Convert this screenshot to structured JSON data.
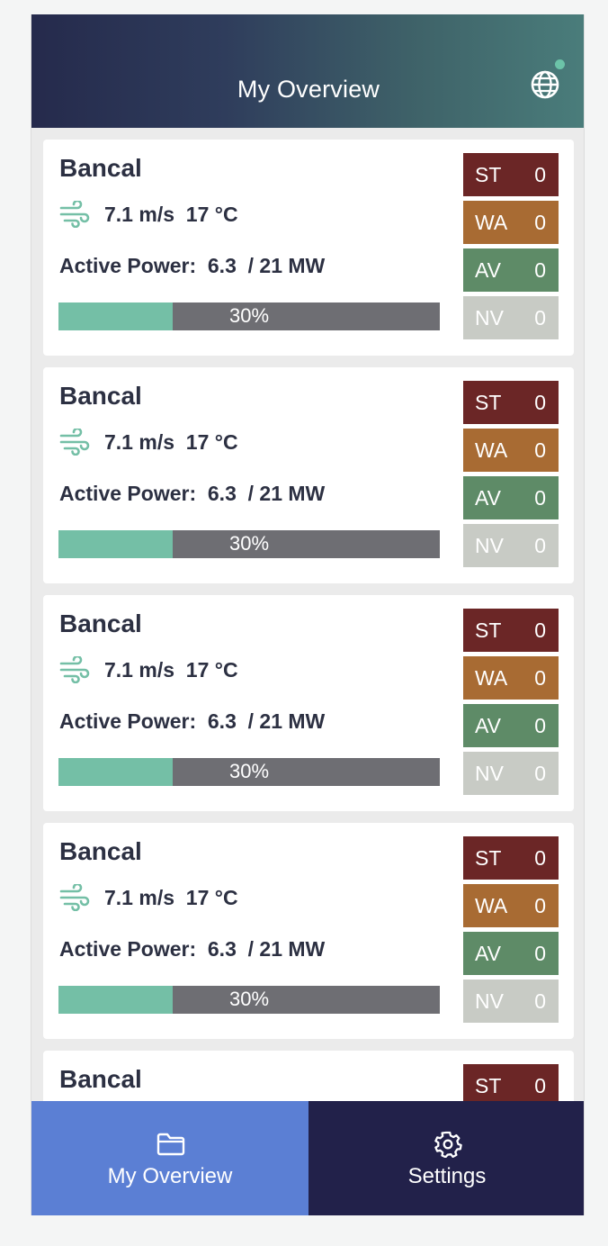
{
  "header": {
    "title": "My Overview",
    "language_icon": "globe-icon",
    "notification_color": "#6cc3a8"
  },
  "colors": {
    "header_gradient_start": "#252a4c",
    "header_gradient_end": "#4a7d7b",
    "progress_fill": "#74bfa6",
    "progress_track": "#6e6e73",
    "status_st": "#6b2626",
    "status_wa": "#a86b33",
    "status_av": "#5e8b67",
    "status_nv": "#c8cbc5",
    "nav_active": "#5b7fd4",
    "nav_inactive": "#22214a"
  },
  "sites": [
    {
      "name": "Bancal",
      "wind_icon": "wind-icon",
      "weather": "7.1 m/s  17 °C",
      "power": "Active Power:  6.3  / 21 MW",
      "progress_percent": 30,
      "progress_label": "30%",
      "statuses": [
        {
          "code": "ST",
          "count": "0"
        },
        {
          "code": "WA",
          "count": "0"
        },
        {
          "code": "AV",
          "count": "0"
        },
        {
          "code": "NV",
          "count": "0"
        }
      ]
    },
    {
      "name": "Bancal",
      "wind_icon": "wind-icon",
      "weather": "7.1 m/s  17 °C",
      "power": "Active Power:  6.3  / 21 MW",
      "progress_percent": 30,
      "progress_label": "30%",
      "statuses": [
        {
          "code": "ST",
          "count": "0"
        },
        {
          "code": "WA",
          "count": "0"
        },
        {
          "code": "AV",
          "count": "0"
        },
        {
          "code": "NV",
          "count": "0"
        }
      ]
    },
    {
      "name": "Bancal",
      "wind_icon": "wind-icon",
      "weather": "7.1 m/s  17 °C",
      "power": "Active Power:  6.3  / 21 MW",
      "progress_percent": 30,
      "progress_label": "30%",
      "statuses": [
        {
          "code": "ST",
          "count": "0"
        },
        {
          "code": "WA",
          "count": "0"
        },
        {
          "code": "AV",
          "count": "0"
        },
        {
          "code": "NV",
          "count": "0"
        }
      ]
    },
    {
      "name": "Bancal",
      "wind_icon": "wind-icon",
      "weather": "7.1 m/s  17 °C",
      "power": "Active Power:  6.3  / 21 MW",
      "progress_percent": 30,
      "progress_label": "30%",
      "statuses": [
        {
          "code": "ST",
          "count": "0"
        },
        {
          "code": "WA",
          "count": "0"
        },
        {
          "code": "AV",
          "count": "0"
        },
        {
          "code": "NV",
          "count": "0"
        }
      ]
    },
    {
      "name": "Bancal",
      "statuses": [
        {
          "code": "ST",
          "count": "0"
        }
      ]
    }
  ],
  "bottom_nav": {
    "items": [
      {
        "label": "My Overview",
        "icon": "folder-icon",
        "active": true
      },
      {
        "label": "Settings",
        "icon": "gear-icon",
        "active": false
      }
    ]
  }
}
